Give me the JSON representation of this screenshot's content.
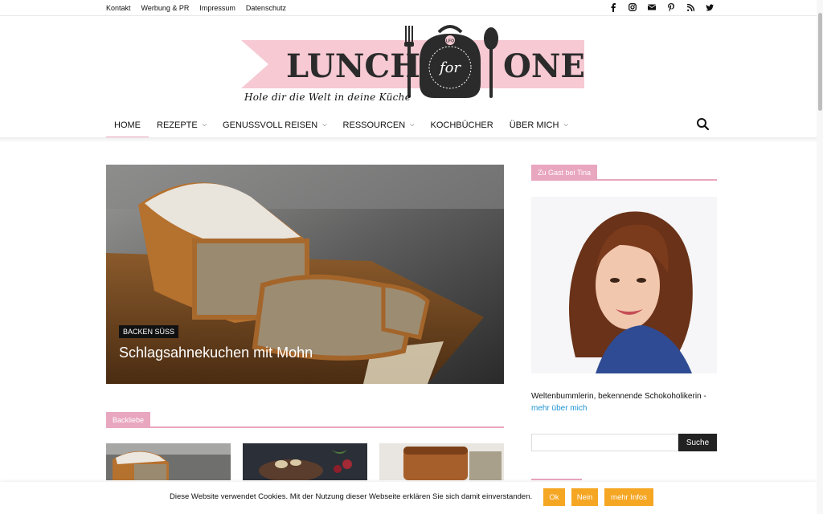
{
  "topbar": {
    "links": [
      "Kontakt",
      "Werbung & PR",
      "Impressum",
      "Datenschutz"
    ],
    "social_icons": [
      "facebook-icon",
      "instagram-icon",
      "mail-icon",
      "pinterest-icon",
      "rss-icon",
      "twitter-icon"
    ]
  },
  "logo": {
    "word1": "LUNCH",
    "word_middle": "for",
    "word2": "ONE",
    "badge": "LFO",
    "tagline": "Hole dir die Welt in deine Küche"
  },
  "nav": {
    "items": [
      {
        "label": "HOME",
        "dropdown": false
      },
      {
        "label": "REZEPTE",
        "dropdown": true
      },
      {
        "label": "GENUSSVOLL REISEN",
        "dropdown": true
      },
      {
        "label": "RESSOURCEN",
        "dropdown": true
      },
      {
        "label": "KOCHBÜCHER",
        "dropdown": false
      },
      {
        "label": "ÜBER MICH",
        "dropdown": true
      }
    ]
  },
  "hero": {
    "category": "BACKEN SÜSS",
    "title": "Schlagsahnekuchen mit Mohn"
  },
  "section": {
    "title": "Backliebe"
  },
  "sidebar": {
    "widget_title": "Zu Gast bei Tina",
    "bio": "Weltenbummlerin, bekennende Schokoholikerin -",
    "bio_link": "mehr über mich",
    "search_button": "Suche"
  },
  "cookie": {
    "text": "Diese Website verwendet Cookies. Mit der Nutzung dieser Webseite erklären Sie sich damit einverstanden.",
    "ok": "Ok",
    "no": "Nein",
    "more": "mehr Infos"
  },
  "colors": {
    "accent_pink": "#e9a6bf",
    "cookie_button": "#f5a623",
    "link_blue": "#1f93d3"
  }
}
